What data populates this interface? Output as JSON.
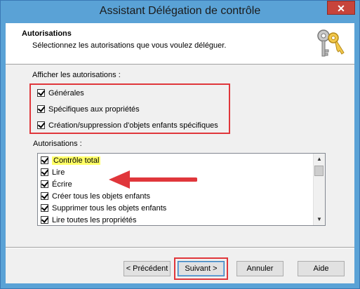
{
  "window": {
    "title": "Assistant Délégation de contrôle",
    "close_symbol": "✕"
  },
  "header": {
    "title": "Autorisations",
    "subtitle": "Sélectionnez les autorisations que vous voulez déléguer.",
    "icon": "keys-icon"
  },
  "show_permissions": {
    "label": "Afficher les autorisations :",
    "options": [
      {
        "label": "Générales",
        "checked": true
      },
      {
        "label": "Spécifiques aux propriétés",
        "checked": true
      },
      {
        "label": "Création/suppression d'objets enfants spécifiques",
        "checked": true
      }
    ]
  },
  "permissions": {
    "label": "Autorisations :",
    "items": [
      {
        "label": "Contrôle total",
        "checked": true
      },
      {
        "label": "Lire",
        "checked": true
      },
      {
        "label": "Écrire",
        "checked": true
      },
      {
        "label": "Créer tous les objets enfants",
        "checked": true
      },
      {
        "label": "Supprimer tous les objets enfants",
        "checked": true
      },
      {
        "label": "Lire toutes les propriétés",
        "checked": true
      }
    ]
  },
  "buttons": {
    "back": "< Précédent",
    "next": "Suivant >",
    "cancel": "Annuler",
    "help": "Aide"
  },
  "colors": {
    "annotation_red": "#e0363b",
    "highlight_yellow": "#ffff66",
    "titlebar_blue": "#5aa2d6"
  }
}
